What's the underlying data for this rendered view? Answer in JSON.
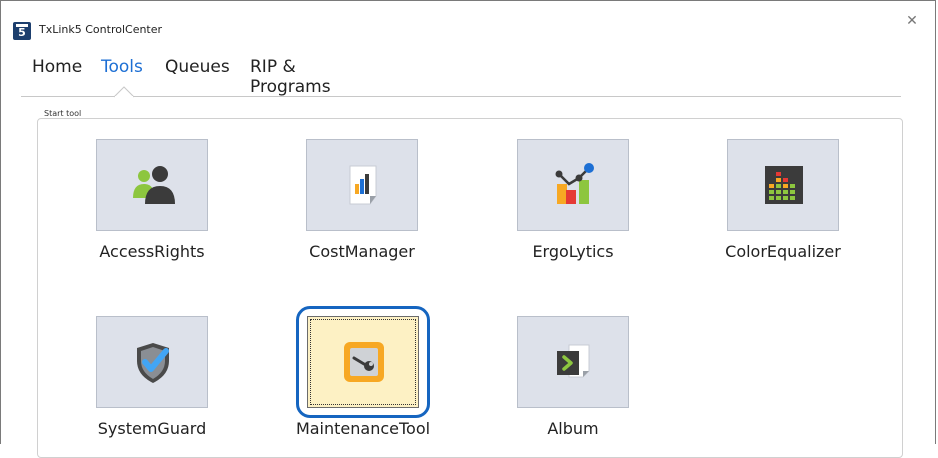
{
  "window": {
    "title": "TxLink5 ControlCenter",
    "app_icon_glyph": "5",
    "close_glyph": "✕"
  },
  "menu": {
    "items": [
      {
        "label": "Home",
        "active": false
      },
      {
        "label": "Tools",
        "active": true
      },
      {
        "label": "Queues",
        "active": false
      },
      {
        "label": "RIP & Programs",
        "active": false
      }
    ]
  },
  "group": {
    "label": "Start tool"
  },
  "tools": [
    {
      "label": "AccessRights",
      "icon": "users-icon",
      "selected": false
    },
    {
      "label": "CostManager",
      "icon": "bar-document-icon",
      "selected": false
    },
    {
      "label": "ErgoLytics",
      "icon": "analytics-chart-icon",
      "selected": false
    },
    {
      "label": "ColorEqualizer",
      "icon": "equalizer-icon",
      "selected": false
    },
    {
      "label": "SystemGuard",
      "icon": "shield-check-icon",
      "selected": false
    },
    {
      "label": "MaintenanceTool",
      "icon": "wrench-icon",
      "selected": true
    },
    {
      "label": "Album",
      "icon": "album-document-icon",
      "selected": false
    }
  ],
  "colors": {
    "accent": "#1d6fd4",
    "selection_ring": "#1565c0",
    "tile_bg": "#dde1ea",
    "tile_selected_bg": "#fdf1c4"
  }
}
